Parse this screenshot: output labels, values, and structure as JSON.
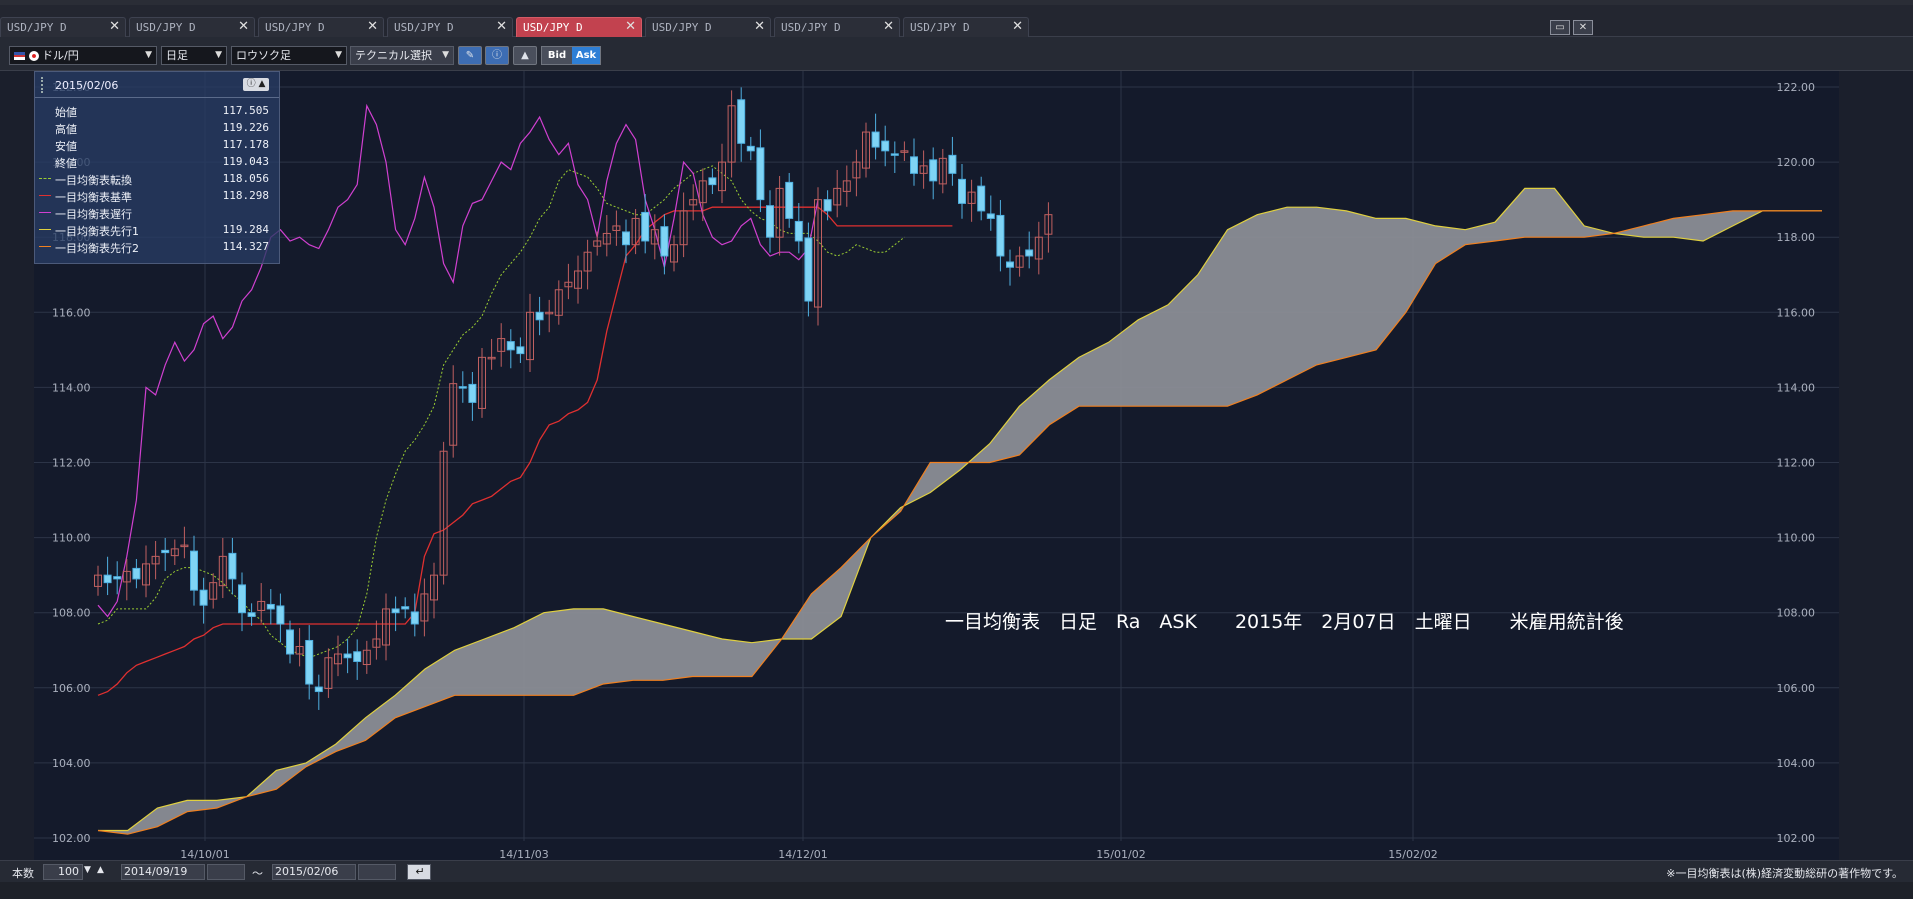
{
  "tabs": [
    {
      "label": "USD/JPY D",
      "close": "✕",
      "active": false
    },
    {
      "label": "USD/JPY D",
      "close": "✕",
      "active": false
    },
    {
      "label": "USD/JPY D",
      "close": "✕",
      "active": false
    },
    {
      "label": "USD/JPY D",
      "close": "✕",
      "active": false
    },
    {
      "label": "USD/JPY D",
      "close": "✕",
      "active": true
    },
    {
      "label": "USD/JPY D",
      "close": "✕",
      "active": false
    },
    {
      "label": "USD/JPY D",
      "close": "✕",
      "active": false
    },
    {
      "label": "USD/JPY D",
      "close": "✕",
      "active": false
    }
  ],
  "toolbar": {
    "currency_pair": "ドル/円",
    "period": "日足",
    "chart_type": "ロウソク足",
    "technical": "テクニカル選択",
    "bid_label": "Bid",
    "ask_label": "Ask"
  },
  "info_panel": {
    "date": "2015/02/06",
    "rows": [
      {
        "label": "始値",
        "value": "117.505",
        "color": ""
      },
      {
        "label": "高値",
        "value": "119.226",
        "color": ""
      },
      {
        "label": "安値",
        "value": "117.178",
        "color": ""
      },
      {
        "label": "終値",
        "value": "119.043",
        "color": ""
      },
      {
        "label": "一目均衡表転換",
        "value": "118.056",
        "color": "#9acd32"
      },
      {
        "label": "一目均衡表基準",
        "value": "118.298",
        "color": "#e03030"
      },
      {
        "label": "一目均衡表遅行",
        "value": "",
        "color": "#d040d0"
      },
      {
        "label": "一目均衡表先行1",
        "value": "119.284",
        "color": "#e0d040"
      },
      {
        "label": "一目均衡表先行2",
        "value": "114.327",
        "color": "#f08020"
      }
    ]
  },
  "annotation": "一目均衡表　日足　Ra　ASK　　2015年　2月07日　土曜日　　米雇用統計後",
  "footer": {
    "count_label": "本数",
    "count_value": "100",
    "start_date": "2014/09/19",
    "tilde": "～",
    "end_date": "2015/02/06",
    "copyright": "※一目均衡表は(株)経済変動総研の著作物です。"
  },
  "chart_data": {
    "type": "candlestick",
    "title": "",
    "y_ticks": [
      "122.00",
      "120.00",
      "118.00",
      "116.00",
      "114.00",
      "112.00",
      "110.00",
      "108.00",
      "106.00",
      "104.00",
      "102.00"
    ],
    "ylim": [
      102,
      122
    ],
    "x_ticks": [
      "14/10/01",
      "14/11/03",
      "14/12/01",
      "15/01/02",
      "15/02/02"
    ],
    "series": [
      {
        "name": "一目均衡表転換",
        "color": "#9acd32"
      },
      {
        "name": "一目均衡表基準",
        "color": "#e03030"
      },
      {
        "name": "一目均衡表遅行",
        "color": "#d040d0"
      },
      {
        "name": "一目均衡表先行1",
        "color": "#e0d040"
      },
      {
        "name": "一目均衡表先行2",
        "color": "#f08020"
      }
    ],
    "candles_close": [
      109.0,
      108.8,
      108.9,
      109.1,
      108.9,
      109.3,
      109.5,
      109.6,
      109.7,
      109.8,
      108.6,
      108.2,
      108.8,
      109.5,
      108.9,
      108.0,
      107.9,
      108.3,
      108.1,
      107.7,
      106.9,
      107.1,
      106.1,
      105.9,
      106.8,
      106.9,
      106.8,
      106.7,
      107.0,
      107.3,
      108.1,
      108.0,
      108.1,
      107.7,
      108.5,
      109.0,
      112.3,
      114.1,
      114.0,
      113.6,
      114.8,
      114.8,
      115.3,
      115.0,
      114.9,
      116.0,
      115.8,
      116.0,
      116.6,
      116.8,
      117.1,
      117.6,
      117.9,
      118.1,
      118.3,
      117.8,
      118.5,
      117.9,
      118.2,
      117.5,
      117.8,
      118.7,
      119.0,
      119.5,
      119.4,
      120.0,
      121.5,
      120.5,
      120.3,
      119.0,
      118.0,
      119.3,
      118.5,
      117.9,
      116.3,
      119.0,
      118.7,
      119.3,
      119.5,
      120.0,
      120.8,
      120.4,
      120.3,
      120.2,
      120.3,
      119.7,
      119.9,
      119.5,
      120.1,
      119.7,
      118.9,
      119.2,
      118.7,
      118.5,
      117.5,
      117.2,
      117.5,
      117.5,
      118.0,
      118.6
    ]
  }
}
